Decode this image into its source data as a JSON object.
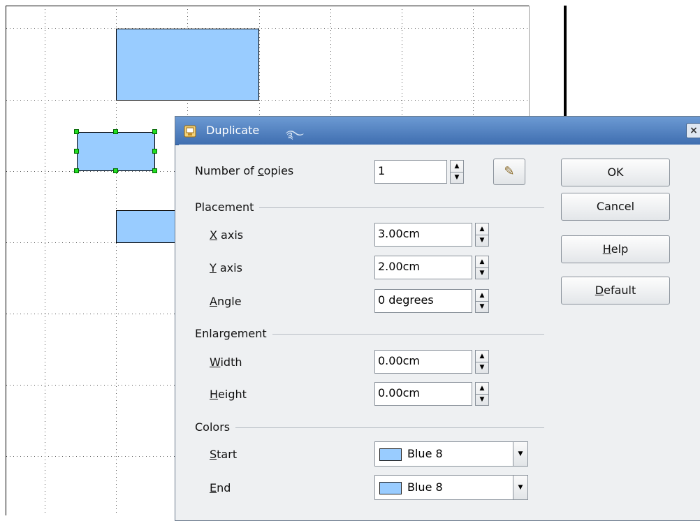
{
  "dialog": {
    "title": "Duplicate",
    "close_glyph": "×",
    "app_icon": "impress-app-icon",
    "fields": {
      "copies": {
        "label_pre": "Number of ",
        "label_key": "c",
        "label_post": "opies",
        "value": "1"
      }
    },
    "placement": {
      "title": "Placement",
      "x_axis": {
        "label_key": "X",
        "label_post": " axis",
        "value": "3.00cm"
      },
      "y_axis": {
        "label_key": "Y",
        "label_post": " axis",
        "value": "2.00cm"
      },
      "angle": {
        "label_key": "A",
        "label_post": "ngle",
        "value": "0 degrees"
      }
    },
    "enlargement": {
      "title": "Enlargement",
      "width": {
        "label_key": "W",
        "label_post": "idth",
        "value": "0.00cm"
      },
      "height": {
        "label_key": "H",
        "label_post": "eight",
        "value": "0.00cm"
      }
    },
    "colors": {
      "title": "Colors",
      "start": {
        "label_key": "S",
        "label_post": "tart",
        "value": "Blue 8",
        "swatch": "#99ccff"
      },
      "end": {
        "label_key": "E",
        "label_post": "nd",
        "value": "Blue 8",
        "swatch": "#99ccff"
      }
    },
    "buttons": {
      "ok": {
        "label": "OK"
      },
      "cancel": {
        "label": "Cancel"
      },
      "help": {
        "label_key": "H",
        "label_post": "elp"
      },
      "default": {
        "label_key": "D",
        "label_post": "efault"
      }
    }
  },
  "canvas": {
    "shape_fill": "#99ccff",
    "handle_color": "#22dd22"
  }
}
